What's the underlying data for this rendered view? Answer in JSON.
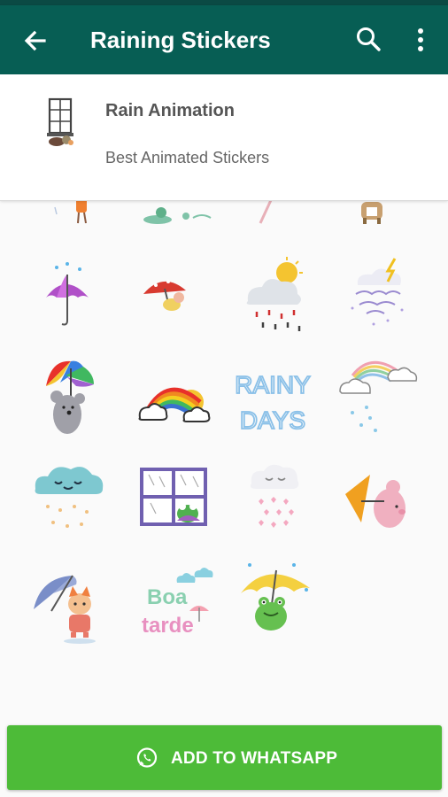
{
  "app_bar": {
    "title": "Raining Stickers",
    "back_icon": "arrow-left-icon",
    "search_icon": "search-icon",
    "more_icon": "more-vertical-icon",
    "color": "#075e54"
  },
  "sticker_pack": {
    "name": "Rain Animation",
    "description": "Best Animated Stickers",
    "tray_icon": "window-icon"
  },
  "stickers": [
    {
      "icon": "girl-legs-sticker"
    },
    {
      "icon": "frog-puddle-sticker"
    },
    {
      "icon": "umbrella-tip-sticker"
    },
    {
      "icon": "dog-sticker"
    },
    {
      "icon": "purple-umbrella-sticker"
    },
    {
      "icon": "mushroom-umbrella-sticker"
    },
    {
      "icon": "sun-cloud-rain-sticker"
    },
    {
      "icon": "happy-rainy-days-sticker"
    },
    {
      "icon": "rainbow-umbrella-mouse-sticker"
    },
    {
      "icon": "rainbow-clouds-sticker"
    },
    {
      "icon": "rainy-days-text-sticker",
      "text": "RAINY DAYS"
    },
    {
      "icon": "rainbow-clouds-rain-sticker"
    },
    {
      "icon": "smiling-cloud-sticker"
    },
    {
      "icon": "window-frog-sticker"
    },
    {
      "icon": "cloud-hearts-sticker"
    },
    {
      "icon": "pig-umbrella-sticker"
    },
    {
      "icon": "fox-umbrella-sticker"
    },
    {
      "icon": "boa-tarde-sticker",
      "text": "Boa tarde"
    },
    {
      "icon": "frog-yellow-umbrella-sticker"
    }
  ],
  "add_button": {
    "label": "ADD TO WHATSAPP",
    "icon": "whatsapp-icon",
    "color": "#4dbb38"
  }
}
